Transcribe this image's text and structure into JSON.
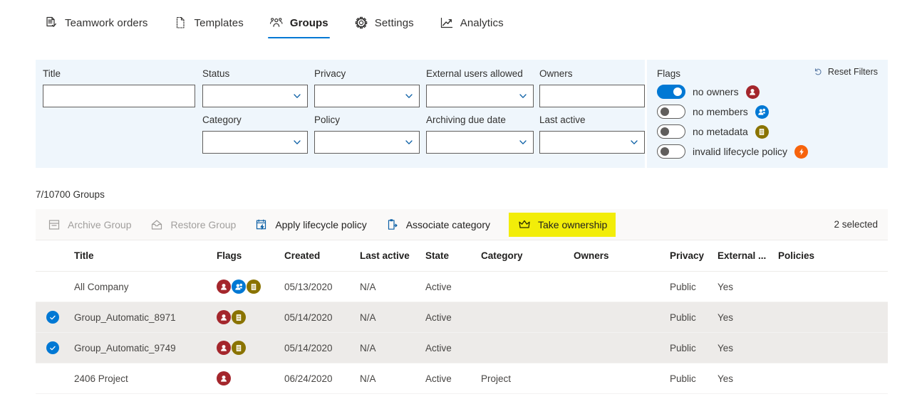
{
  "pivot": {
    "items": [
      {
        "label": "Teamwork orders",
        "icon": "document-check-icon",
        "selected": false
      },
      {
        "label": "Templates",
        "icon": "template-page-icon",
        "selected": false
      },
      {
        "label": "Groups",
        "icon": "people-group-icon",
        "selected": true
      },
      {
        "label": "Settings",
        "icon": "gear-icon",
        "selected": false
      },
      {
        "label": "Analytics",
        "icon": "line-chart-icon",
        "selected": false
      }
    ]
  },
  "filters": {
    "reset_label": "Reset Filters",
    "reset_icon": "undo-arrow-icon",
    "flags_title": "Flags",
    "fields": [
      {
        "label": "Title",
        "value": "",
        "type": "text",
        "name": "filter-title"
      },
      {
        "label": "Status",
        "value": "",
        "type": "select",
        "name": "filter-status"
      },
      {
        "label": "Privacy",
        "value": "",
        "type": "select",
        "name": "filter-privacy"
      },
      {
        "label": "External users allowed",
        "value": "",
        "type": "select",
        "name": "filter-external-users-allowed"
      },
      {
        "label": "Owners",
        "value": "",
        "type": "text",
        "name": "filter-owners"
      },
      {
        "label": "Category",
        "value": "",
        "type": "select",
        "name": "filter-category"
      },
      {
        "label": "Policy",
        "value": "",
        "type": "select",
        "name": "filter-policy"
      },
      {
        "label": "Archiving due date",
        "value": "",
        "type": "select",
        "name": "filter-archiving-due-date"
      },
      {
        "label": "Last active",
        "value": "",
        "type": "select",
        "name": "filter-last-active"
      }
    ],
    "flags": [
      {
        "label": "no owners",
        "on": true,
        "badge": "no-owners-badge-icon",
        "color": "#a4262c"
      },
      {
        "label": "no members",
        "on": false,
        "badge": "no-members-badge-icon",
        "color": "#0078d4"
      },
      {
        "label": "no metadata",
        "on": false,
        "badge": "no-metadata-badge-icon",
        "color": "#8a7300"
      },
      {
        "label": "invalid lifecycle policy",
        "on": false,
        "badge": "invalid-policy-badge-icon",
        "color": "#f7630c"
      }
    ]
  },
  "count_label": "7/10700 Groups",
  "commandbar": {
    "selected_label": "2 selected",
    "commands": [
      {
        "label": "Archive Group",
        "icon": "archive-icon",
        "disabled": true,
        "highlight": false,
        "name": "archive-group-button"
      },
      {
        "label": "Restore Group",
        "icon": "restore-icon",
        "disabled": true,
        "highlight": false,
        "name": "restore-group-button"
      },
      {
        "label": "Apply lifecycle policy",
        "icon": "lifecycle-policy-icon",
        "disabled": false,
        "highlight": false,
        "name": "apply-lifecycle-policy-button"
      },
      {
        "label": "Associate category",
        "icon": "associate-category-icon",
        "disabled": false,
        "highlight": false,
        "name": "associate-category-button"
      },
      {
        "label": "Take ownership",
        "icon": "crown-icon",
        "disabled": false,
        "highlight": true,
        "name": "take-ownership-button"
      }
    ]
  },
  "table": {
    "columns": [
      "Title",
      "Flags",
      "Created",
      "Last active",
      "State",
      "Category",
      "Owners",
      "Privacy",
      "External ...",
      "Policies"
    ],
    "rows": [
      {
        "selected": false,
        "title": "All Company",
        "flags": [
          "no-owners-badge-icon",
          "no-members-badge-icon",
          "no-metadata-badge-icon"
        ],
        "created": "05/13/2020",
        "last_active": "N/A",
        "state": "Active",
        "category": "",
        "owners": "",
        "privacy": "Public",
        "external": "Yes",
        "policies": ""
      },
      {
        "selected": true,
        "title": "Group_Automatic_8971",
        "flags": [
          "no-owners-badge-icon",
          "no-metadata-badge-icon"
        ],
        "created": "05/14/2020",
        "last_active": "N/A",
        "state": "Active",
        "category": "",
        "owners": "",
        "privacy": "Public",
        "external": "Yes",
        "policies": ""
      },
      {
        "selected": true,
        "title": "Group_Automatic_9749",
        "flags": [
          "no-owners-badge-icon",
          "no-metadata-badge-icon"
        ],
        "created": "05/14/2020",
        "last_active": "N/A",
        "state": "Active",
        "category": "",
        "owners": "",
        "privacy": "Public",
        "external": "Yes",
        "policies": ""
      },
      {
        "selected": false,
        "title": "2406 Project",
        "flags": [
          "no-owners-badge-icon"
        ],
        "created": "06/24/2020",
        "last_active": "N/A",
        "state": "Active",
        "category": "Project",
        "owners": "",
        "privacy": "Public",
        "external": "Yes",
        "policies": ""
      }
    ]
  }
}
